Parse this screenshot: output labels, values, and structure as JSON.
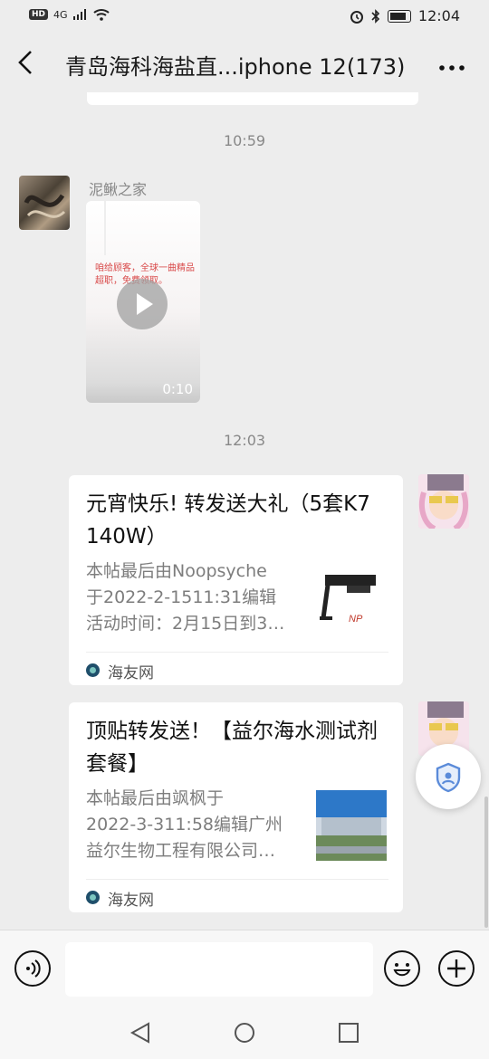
{
  "status_bar": {
    "network": "HD",
    "signal": "4G",
    "time": "12:04"
  },
  "header": {
    "title": "青岛海科海盐直...iphone 12(173)",
    "back_icon": "chevron-left-icon",
    "more_icon": "ellipsis-icon"
  },
  "timestamps": [
    "10:59",
    "12:03"
  ],
  "messages": {
    "video_msg": {
      "sender": "泥鳅之家",
      "overlay_text": "咱给顾客，全球一曲精品超职，免费领取。",
      "duration": "0:10"
    },
    "card1": {
      "title": "元宵快乐! 转发送大礼（5套K7  140W）",
      "desc": [
        "本帖最后由Noopsyche",
        "于2022-2-1511:31编辑",
        "活动时间：2月15日到3…"
      ],
      "source": "海友网",
      "thumb_logo": "NP"
    },
    "card2": {
      "title": "顶贴转发送！【益尔海水测试剂套餐】",
      "desc": [
        "本帖最后由飒枫于",
        "2022-3-311:58编辑广州",
        "益尔生物工程有限公司…"
      ],
      "source": "海友网"
    }
  },
  "input": {
    "placeholder": "",
    "value": ""
  },
  "icons": {
    "voice": "voice-icon",
    "emoji": "emoji-icon",
    "plus": "plus-icon",
    "shield": "shield-icon"
  },
  "colors": {
    "background": "#ededed",
    "card": "#ffffff",
    "muted_text": "#888888"
  }
}
